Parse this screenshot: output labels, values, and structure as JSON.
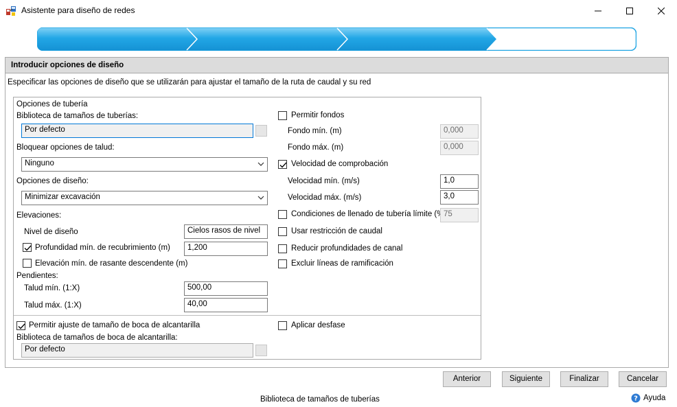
{
  "window": {
    "title": "Asistente para diseño de redes",
    "icons": {
      "app": "network-design-icon",
      "minimize": "minimize-icon",
      "maximize": "maximize-icon",
      "close": "close-icon"
    }
  },
  "progress": {
    "steps_total": 4,
    "steps_done": 3,
    "accent": "#1ea4e3"
  },
  "panel": {
    "header": "Introducir opciones de diseño",
    "description": "Especificar las opciones de diseño que se utilizarán para ajustar el tamaño de la ruta de caudal y su red"
  },
  "pipe": {
    "group_title": "Opciones de tubería",
    "library_label": "Biblioteca de tamaños de tuberías:",
    "library_value": "Por defecto",
    "slope_lock_label": "Bloquear opciones de talud:",
    "slope_lock_value": "Ninguno",
    "design_options_label": "Opciones de diseño:",
    "design_options_value": "Minimizar excavación",
    "elevations_label": "Elevaciones:",
    "design_level_label": "Nivel de diseño",
    "design_level_value": "Cielos rasos de nivel",
    "min_cover_label": "Profundidad mín. de recubrimiento (m)",
    "min_cover_checked": true,
    "min_cover_value": "1,200",
    "min_invert_label": "Elevación mín. de rasante descendente (m)",
    "min_invert_checked": false,
    "slopes_label": "Pendientes:",
    "min_slope_label": "Talud mín. (1:X)",
    "min_slope_value": "500,00",
    "max_slope_label": "Talud máx. (1:X)",
    "max_slope_value": "40,00"
  },
  "right": {
    "allow_sumps_label": "Permitir fondos",
    "allow_sumps_checked": false,
    "min_sump_label": "Fondo mín. (m)",
    "min_sump_value": "0,000",
    "max_sump_label": "Fondo máx. (m)",
    "max_sump_value": "0,000",
    "check_velocity_label": "Velocidad de comprobación",
    "check_velocity_checked": true,
    "min_velocity_label": "Velocidad mín. (m/s)",
    "min_velocity_value": "1,0",
    "max_velocity_label": "Velocidad máx. (m/s)",
    "max_velocity_value": "3,0",
    "fill_label": "Condiciones de llenado de tubería límite (%)",
    "fill_checked": false,
    "fill_value": "75",
    "flow_restriction_label": "Usar restricción de caudal",
    "flow_restriction_checked": false,
    "reduce_depth_label": "Reducir profundidades de canal",
    "reduce_depth_checked": false,
    "exclude_branch_label": "Excluir líneas de ramificación",
    "exclude_branch_checked": false
  },
  "inlet": {
    "allow_resize_label": "Permitir ajuste de tamaño de boca de alcantarilla",
    "allow_resize_checked": true,
    "library_label": "Biblioteca de tamaños de boca de alcantarilla:",
    "library_value": "Por defecto",
    "apply_offset_label": "Aplicar desfase",
    "apply_offset_checked": false
  },
  "buttons": {
    "back": "Anterior",
    "next": "Siguiente",
    "finish": "Finalizar",
    "cancel": "Cancelar"
  },
  "status": "Biblioteca de tamaños de tuberías",
  "help": {
    "label": "Ayuda",
    "icon": "help-icon"
  }
}
